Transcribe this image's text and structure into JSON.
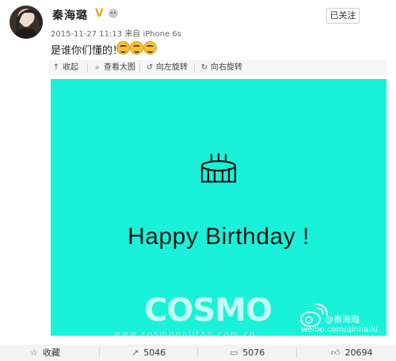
{
  "post": {
    "author": "秦海璐",
    "follow_label": "已关注",
    "timestamp": "2015-11-27 11:13",
    "source": "来自 iPhone 6s",
    "text": "是谁你们懂的！"
  },
  "toolbar": {
    "collapse": "收起",
    "view_large": "查看大图",
    "rotate_left": "向左旋转",
    "rotate_right": "向右旋转"
  },
  "image": {
    "background_color": "#19f2d8",
    "headline": "Happy Birthday !",
    "watermark_logo": "COSMO",
    "watermark_user": "@秦海璐",
    "watermark_site": "weibo.com/qinhailu",
    "cosmo_url": "www.cosmopolitan.com.cn"
  },
  "actions": {
    "favorite": "收藏",
    "repost_count": "5046",
    "comment_count": "5076",
    "like_count": "20694"
  }
}
